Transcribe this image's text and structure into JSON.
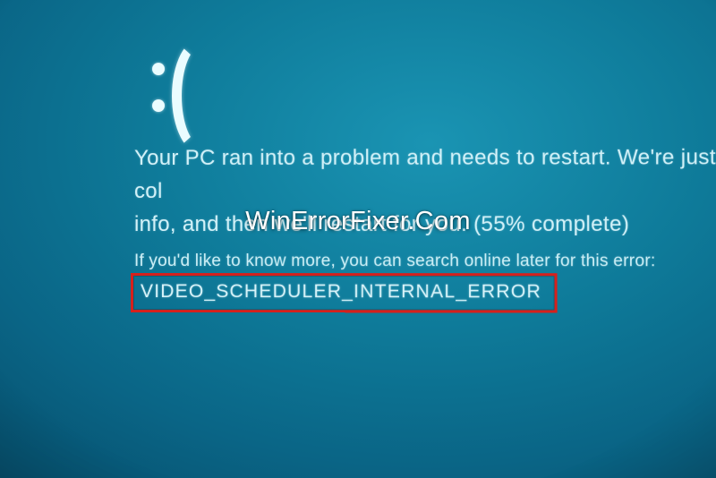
{
  "bsod": {
    "message_primary": "Your PC ran into a problem and needs to restart. We're just col\ninfo, and then we'll restart for you. (55% complete)",
    "message_hint": "If you'd like to know more, you can search online later for this error:",
    "error_code": "VIDEO_SCHEDULER_INTERNAL_ERROR",
    "progress_percent": 55
  },
  "watermark": "WinErrorFixer.Com",
  "highlight_color": "#d6201c"
}
